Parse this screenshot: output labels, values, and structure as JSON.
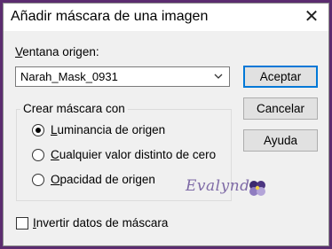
{
  "dialog": {
    "title": "Añadir máscara de una imagen"
  },
  "source": {
    "label_first": "V",
    "label_rest": "entana origen:",
    "selected_value": "Narah_Mask_0931"
  },
  "buttons": {
    "accept": "Aceptar",
    "cancel": "Cancelar",
    "help": "Ayuda"
  },
  "mask_group": {
    "title": "Crear máscara con",
    "options": [
      {
        "first": "L",
        "rest": "uminancia de origen",
        "selected": true
      },
      {
        "first": "C",
        "rest": "ualquier valor distinto de cero",
        "selected": false
      },
      {
        "first": "O",
        "rest": "pacidad de origen",
        "selected": false
      }
    ]
  },
  "invert": {
    "first": "I",
    "rest": "nvertir datos de máscara",
    "checked": false
  },
  "watermark": {
    "text": "Evalynda"
  },
  "colors": {
    "outer_background": "#5b2c6f",
    "primary_border": "#0078d7"
  }
}
